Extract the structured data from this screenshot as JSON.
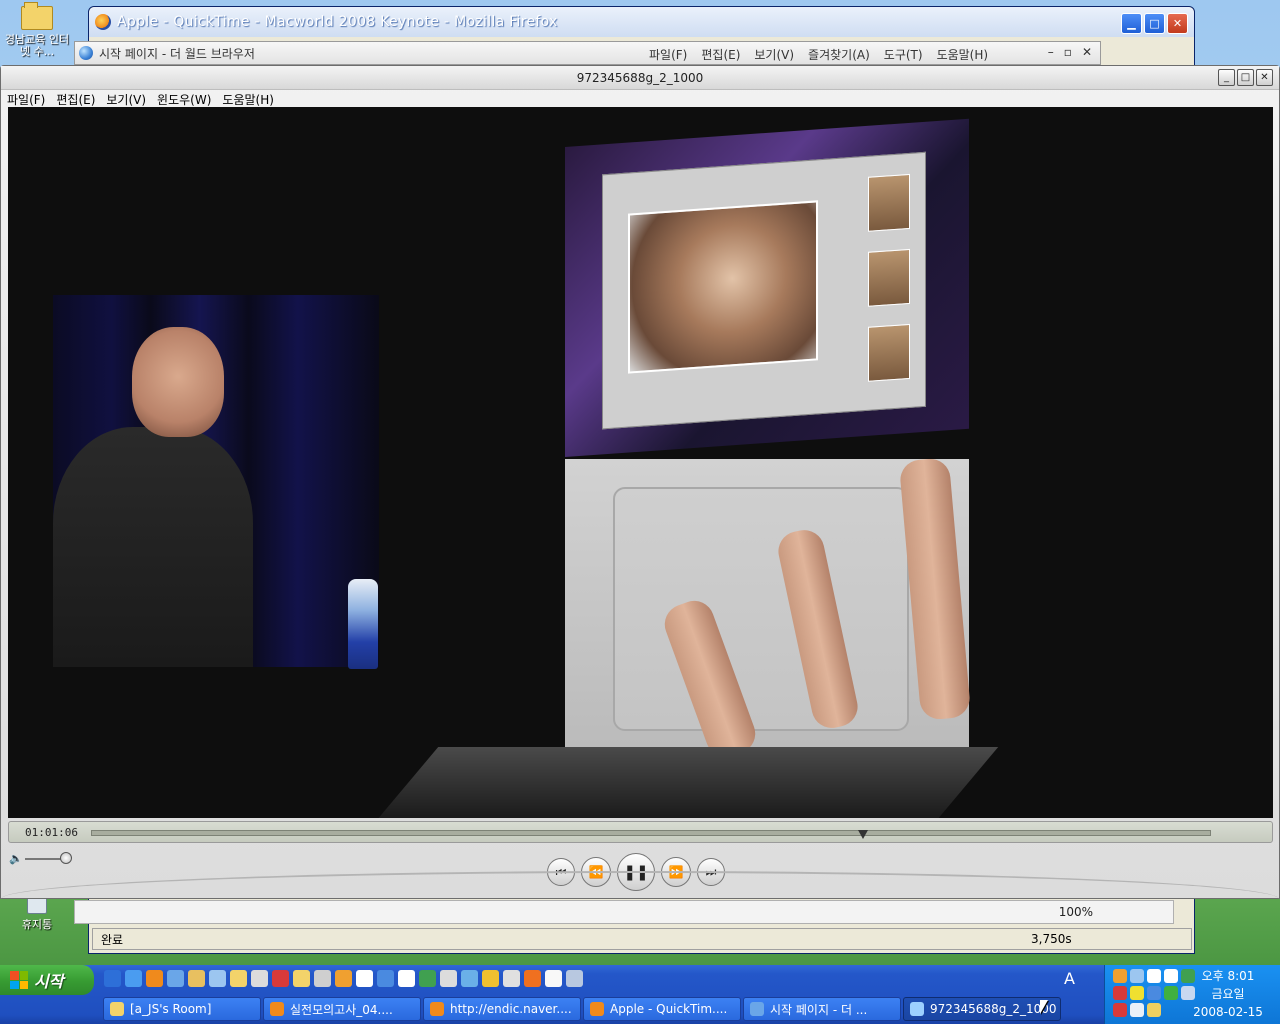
{
  "desktop": {
    "icons": [
      {
        "label": "경남교육 인터넷 수...",
        "icon": "folder-icon"
      },
      {
        "label": "휴지통",
        "icon": "recycle-bin-icon"
      }
    ]
  },
  "firefox": {
    "title": "Apple - QuickTime - Macworld 2008 Keynote - Mozilla Firefox",
    "status": "완료",
    "transfer": "3,750s",
    "zoom": "100%"
  },
  "world_browser": {
    "title": "시작 페이지 - 더 월드 브라우저",
    "menu": [
      "파일(F)",
      "편집(E)",
      "보기(V)",
      "즐겨찾기(A)",
      "도구(T)",
      "도움말(H)"
    ]
  },
  "quicktime": {
    "title": "972345688g_2_1000",
    "menu": [
      "파일(F)",
      "편집(E)",
      "보기(V)",
      "윈도우(W)",
      "도움말(H)"
    ],
    "timecode": "01:01:06",
    "playback": {
      "progress": 0.69,
      "volume": 1.0,
      "state": "playing"
    },
    "controls": [
      "skip-back-icon",
      "rewind-icon",
      "pause-icon",
      "fast-forward-icon",
      "skip-forward-icon"
    ]
  },
  "taskbar": {
    "start_label": "시작",
    "ime": "A",
    "tasks": [
      {
        "label": "[a_JS's Room]",
        "icon": "folder-icon",
        "active": false
      },
      {
        "label": "실전모의고사_04....",
        "icon": "alzip-icon",
        "active": false
      },
      {
        "label": "http://endic.naver....",
        "icon": "firefox-icon",
        "active": false
      },
      {
        "label": "Apple - QuickTim....",
        "icon": "firefox-icon",
        "active": false
      },
      {
        "label": "시작 페이지 - 더 ...",
        "icon": "theworld-icon",
        "active": false
      },
      {
        "label": "972345688g_2_1000",
        "icon": "quicktime-icon",
        "active": true
      }
    ],
    "clock": {
      "time": "오후 8:01",
      "day": "금요일",
      "date": "2008-02-15"
    }
  }
}
